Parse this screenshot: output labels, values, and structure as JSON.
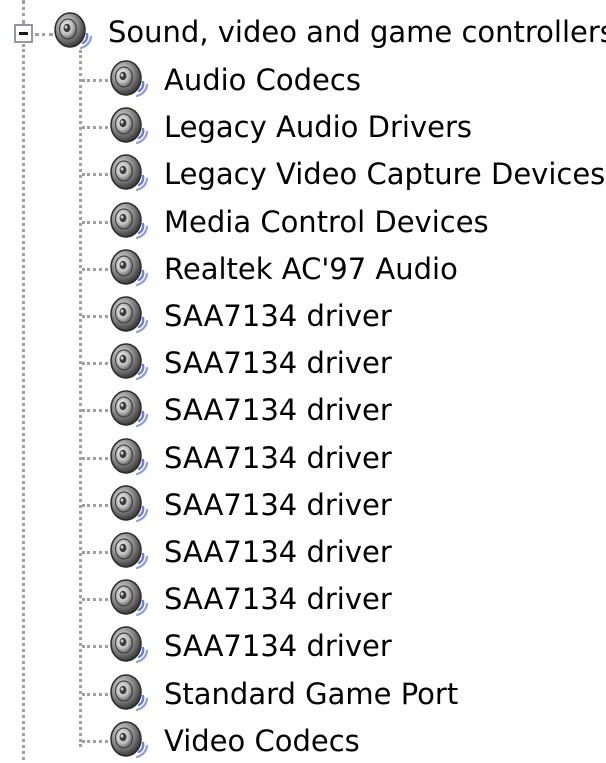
{
  "tree": {
    "root": {
      "label": "Sound, video and game controllers",
      "icon": "speaker-icon",
      "expanded": true,
      "expander_symbol": "minus"
    },
    "children": [
      {
        "label": "Audio Codecs",
        "icon": "speaker-icon"
      },
      {
        "label": "Legacy Audio Drivers",
        "icon": "speaker-icon"
      },
      {
        "label": "Legacy Video Capture Devices",
        "icon": "speaker-icon"
      },
      {
        "label": "Media Control Devices",
        "icon": "speaker-icon"
      },
      {
        "label": "Realtek AC'97 Audio",
        "icon": "speaker-icon"
      },
      {
        "label": "SAA7134 driver",
        "icon": "speaker-icon"
      },
      {
        "label": "SAA7134 driver",
        "icon": "speaker-icon"
      },
      {
        "label": "SAA7134 driver",
        "icon": "speaker-icon"
      },
      {
        "label": "SAA7134 driver",
        "icon": "speaker-icon"
      },
      {
        "label": "SAA7134 driver",
        "icon": "speaker-icon"
      },
      {
        "label": "SAA7134 driver",
        "icon": "speaker-icon"
      },
      {
        "label": "SAA7134 driver",
        "icon": "speaker-icon"
      },
      {
        "label": "SAA7134 driver",
        "icon": "speaker-icon"
      },
      {
        "label": "Standard Game Port",
        "icon": "speaker-icon"
      },
      {
        "label": "Video Codecs",
        "icon": "speaker-icon"
      }
    ]
  },
  "colors": {
    "connector": "#a0a0a0",
    "expander_border": "#8c9aa8",
    "speaker_dark": "#3a3a3a",
    "speaker_mid": "#8e8e8e",
    "speaker_light": "#e6e6e6",
    "sound_wave": "#6b7fd6"
  }
}
